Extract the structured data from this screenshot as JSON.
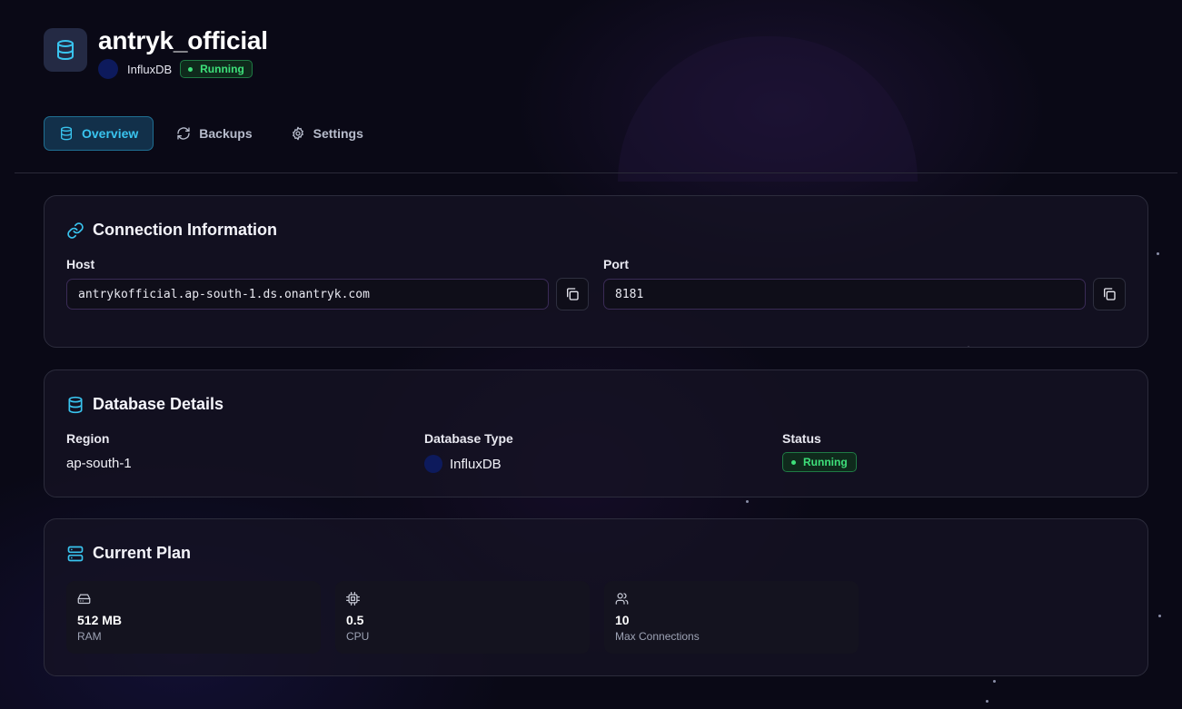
{
  "header": {
    "title": "antryk_official",
    "db_type": "InfluxDB",
    "status": "Running"
  },
  "tabs": [
    {
      "label": "Overview",
      "icon": "database-icon",
      "active": true
    },
    {
      "label": "Backups",
      "icon": "refresh-icon",
      "active": false
    },
    {
      "label": "Settings",
      "icon": "gear-icon",
      "active": false
    }
  ],
  "connection": {
    "title": "Connection Information",
    "host_label": "Host",
    "host_value": "antrykofficial.ap-south-1.ds.onantryk.com",
    "port_label": "Port",
    "port_value": "8181"
  },
  "details": {
    "title": "Database Details",
    "region_label": "Region",
    "region_value": "ap-south-1",
    "type_label": "Database Type",
    "type_value": "InfluxDB",
    "status_label": "Status",
    "status_value": "Running"
  },
  "plan": {
    "title": "Current Plan",
    "items": [
      {
        "value": "512 MB",
        "label": "RAM",
        "icon": "hard-drive-icon"
      },
      {
        "value": "0.5",
        "label": "CPU",
        "icon": "cpu-icon"
      },
      {
        "value": "10",
        "label": "Max Connections",
        "icon": "users-icon"
      }
    ]
  },
  "colors": {
    "accent": "#39c4ef",
    "success": "#3ee07a",
    "background": "#0a0916"
  }
}
